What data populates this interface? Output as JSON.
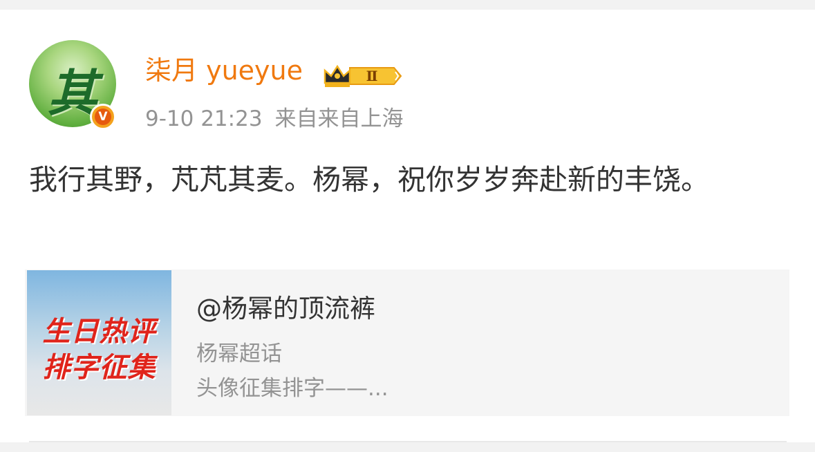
{
  "post": {
    "username": "柒月 yueyue",
    "time": "9-10 21:23",
    "source": "来自来自上海",
    "content": "我行其野，芃芃其麦。杨幂，祝你岁岁奔赴新的丰饶。",
    "avatar_char": "其",
    "verify_mark": "V",
    "vip_level": "Ⅱ"
  },
  "card": {
    "title": "@杨幂的顶流裤",
    "subtitle": "杨幂超话",
    "description": "头像征集排字——...",
    "thumb_line1": "生日热评",
    "thumb_line2": "排字征集"
  },
  "colors": {
    "username": "#f0790f",
    "meta": "#939393",
    "text": "#333333",
    "thumb_text": "#e0241b"
  }
}
